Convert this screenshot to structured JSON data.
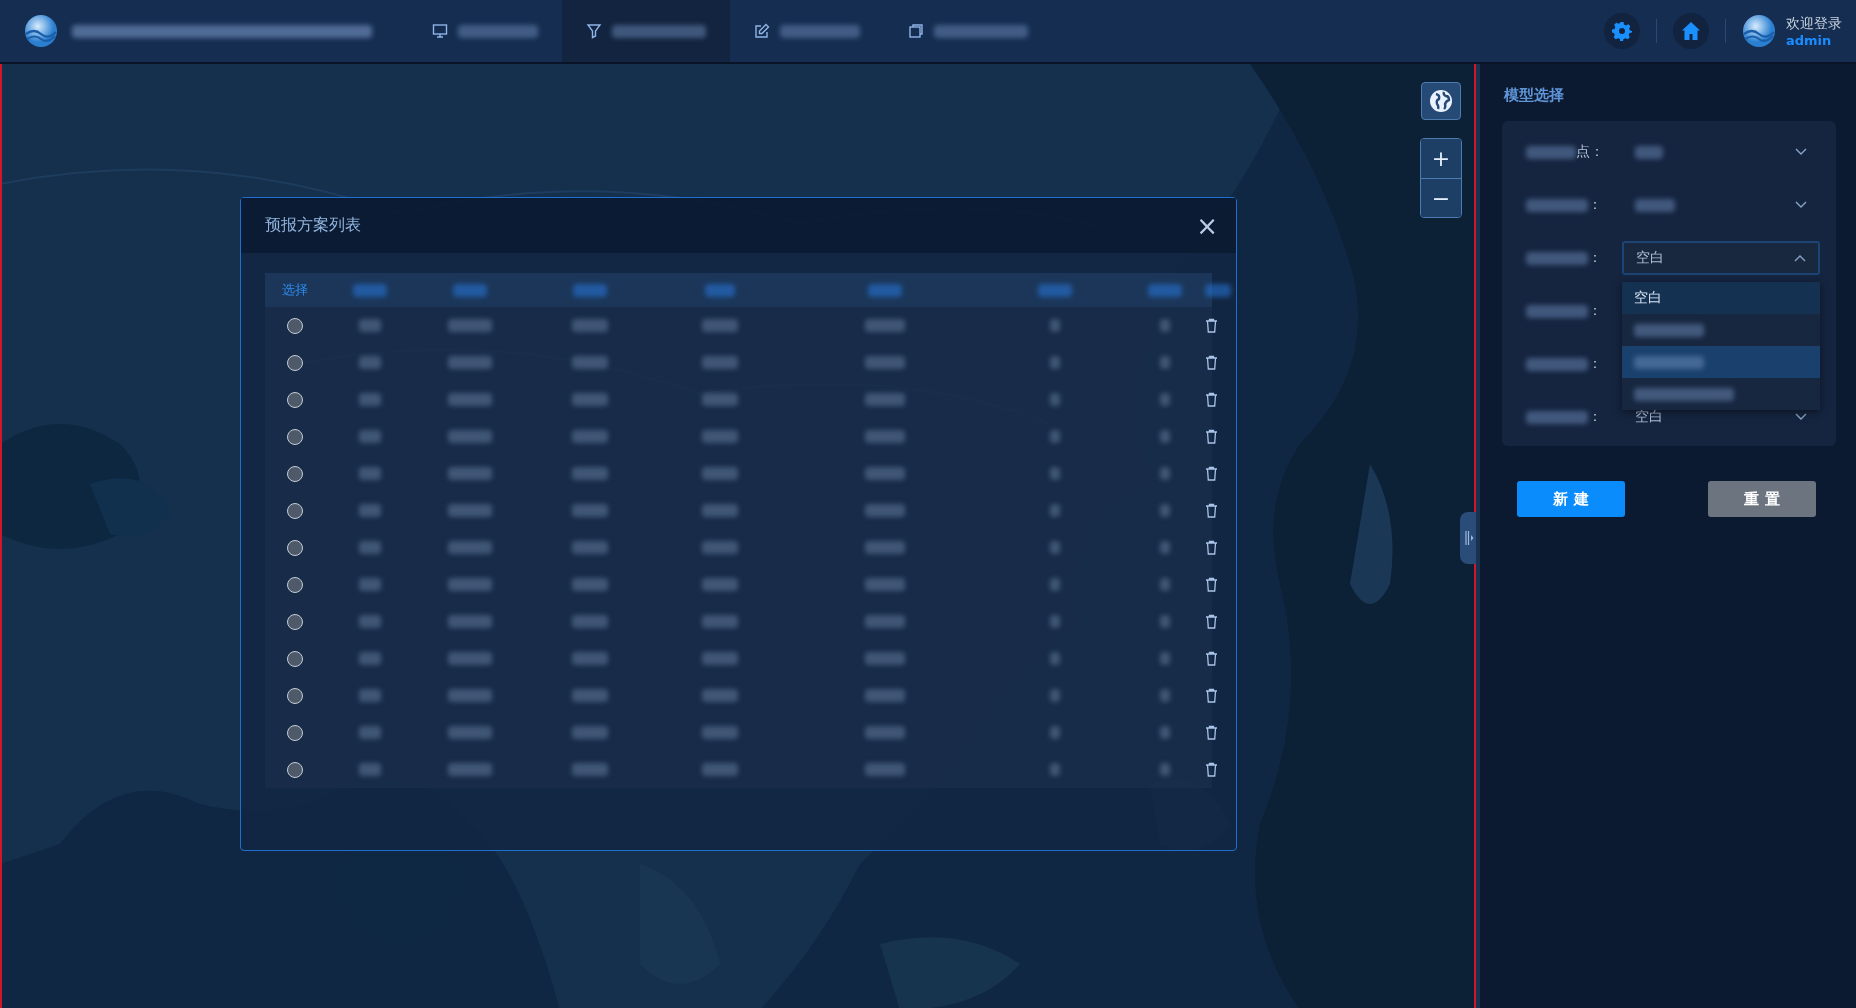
{
  "header": {
    "nav_tabs": [
      {
        "selected": false
      },
      {
        "selected": true
      },
      {
        "selected": false
      },
      {
        "selected": false
      }
    ],
    "user": {
      "greeting": "欢迎登录",
      "username": "admin"
    }
  },
  "map": {
    "kind": "picture",
    "zoom_in": "+",
    "zoom_out": "−"
  },
  "modal": {
    "title": "预报方案列表",
    "close": "×",
    "select_column": "选择",
    "rows": [
      {
        "selected": false
      },
      {
        "selected": false
      },
      {
        "selected": false
      },
      {
        "selected": false
      },
      {
        "selected": false
      },
      {
        "selected": false
      },
      {
        "selected": false
      },
      {
        "selected": false
      },
      {
        "selected": false
      },
      {
        "selected": false
      },
      {
        "selected": false
      },
      {
        "selected": false
      },
      {
        "selected": false
      }
    ]
  },
  "panel": {
    "title": "模型选择",
    "fields": [
      {
        "label_tail": "点：",
        "expanded": false
      },
      {
        "label_tail": "：",
        "expanded": false
      },
      {
        "label_tail": "：",
        "value": "空白",
        "expanded": true
      },
      {
        "label_tail": "："
      },
      {
        "label_tail": "："
      },
      {
        "label_tail": "：",
        "value": "空白",
        "expanded": false
      }
    ],
    "options": [
      {
        "label": "空白",
        "selected": true,
        "hovered": false
      },
      {
        "selected": false,
        "hovered": false
      },
      {
        "selected": false,
        "hovered": true
      },
      {
        "selected": false,
        "hovered": false
      }
    ],
    "buttons": [
      {
        "label": "新 建",
        "kind": "primary"
      },
      {
        "label": "重 置",
        "kind": "secondary"
      }
    ]
  }
}
